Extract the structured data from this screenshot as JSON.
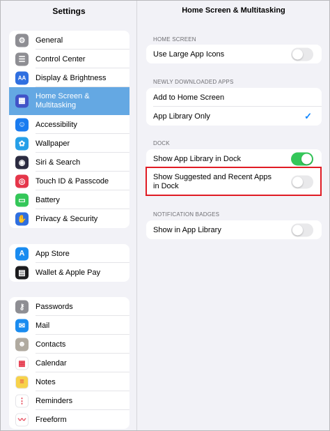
{
  "sidebar": {
    "title": "Settings",
    "groups": [
      [
        {
          "label": "General",
          "icon": "gear-icon",
          "color": "#8e8e93",
          "glyph": "⚙"
        },
        {
          "label": "Control Center",
          "icon": "control-center-icon",
          "color": "#8e8e93",
          "glyph": "☰"
        },
        {
          "label": "Display & Brightness",
          "icon": "display-brightness-icon",
          "color": "#2f6fe0",
          "glyph": "AA"
        },
        {
          "label": "Home Screen &\nMultitasking",
          "icon": "home-screen-icon",
          "color": "#4153c8",
          "glyph": "▦",
          "selected": true
        },
        {
          "label": "Accessibility",
          "icon": "accessibility-icon",
          "color": "#1a7cf0",
          "glyph": "☺"
        },
        {
          "label": "Wallpaper",
          "icon": "wallpaper-icon",
          "color": "#27a0e8",
          "glyph": "✿"
        },
        {
          "label": "Siri & Search",
          "icon": "siri-icon",
          "color": "#2b2b40",
          "glyph": "◉"
        },
        {
          "label": "Touch ID & Passcode",
          "icon": "fingerprint-icon",
          "color": "#e5364a",
          "glyph": "◎"
        },
        {
          "label": "Battery",
          "icon": "battery-icon",
          "color": "#34c759",
          "glyph": "▭"
        },
        {
          "label": "Privacy & Security",
          "icon": "privacy-hand-icon",
          "color": "#2f6fe0",
          "glyph": "✋"
        }
      ],
      [
        {
          "label": "App Store",
          "icon": "app-store-icon",
          "color": "#1a8cf0",
          "glyph": "A"
        },
        {
          "label": "Wallet & Apple Pay",
          "icon": "wallet-icon",
          "color": "#1c1c1e",
          "glyph": "▤"
        }
      ],
      [
        {
          "label": "Passwords",
          "icon": "key-icon",
          "color": "#8e8e93",
          "glyph": "⚷"
        },
        {
          "label": "Mail",
          "icon": "mail-icon",
          "color": "#1a8cf0",
          "glyph": "✉"
        },
        {
          "label": "Contacts",
          "icon": "contacts-icon",
          "color": "#b0aaa0",
          "glyph": "☻"
        },
        {
          "label": "Calendar",
          "icon": "calendar-icon",
          "color": "#ffffff",
          "glyph": "▦"
        },
        {
          "label": "Notes",
          "icon": "notes-icon",
          "color": "#f7d24a",
          "glyph": "≡"
        },
        {
          "label": "Reminders",
          "icon": "reminders-icon",
          "color": "#ffffff",
          "glyph": "⋮"
        },
        {
          "label": "Freeform",
          "icon": "freeform-icon",
          "color": "#ffffff",
          "glyph": "〰"
        }
      ]
    ]
  },
  "main": {
    "title": "Home Screen & Multitasking",
    "sections": {
      "home_screen": {
        "label": "HOME SCREEN",
        "rows": [
          {
            "label": "Use Large App Icons",
            "toggle": false
          }
        ]
      },
      "newly_downloaded": {
        "label": "NEWLY DOWNLOADED APPS",
        "rows": [
          {
            "label": "Add to Home Screen",
            "checked": false
          },
          {
            "label": "App Library Only",
            "checked": true
          }
        ]
      },
      "dock": {
        "label": "DOCK",
        "rows": [
          {
            "label": "Show App Library in Dock",
            "toggle": true
          },
          {
            "label": "Show Suggested and Recent Apps\nin Dock",
            "toggle": false
          }
        ]
      },
      "notification_badges": {
        "label": "NOTIFICATION BADGES",
        "rows": [
          {
            "label": "Show in App Library",
            "toggle": false
          }
        ]
      }
    },
    "checkmark": "✓"
  },
  "colors": {
    "accent": "#0a84ff",
    "toggle_on": "#34c759",
    "selection": "#64a8e3",
    "highlight": "#e01b24"
  }
}
